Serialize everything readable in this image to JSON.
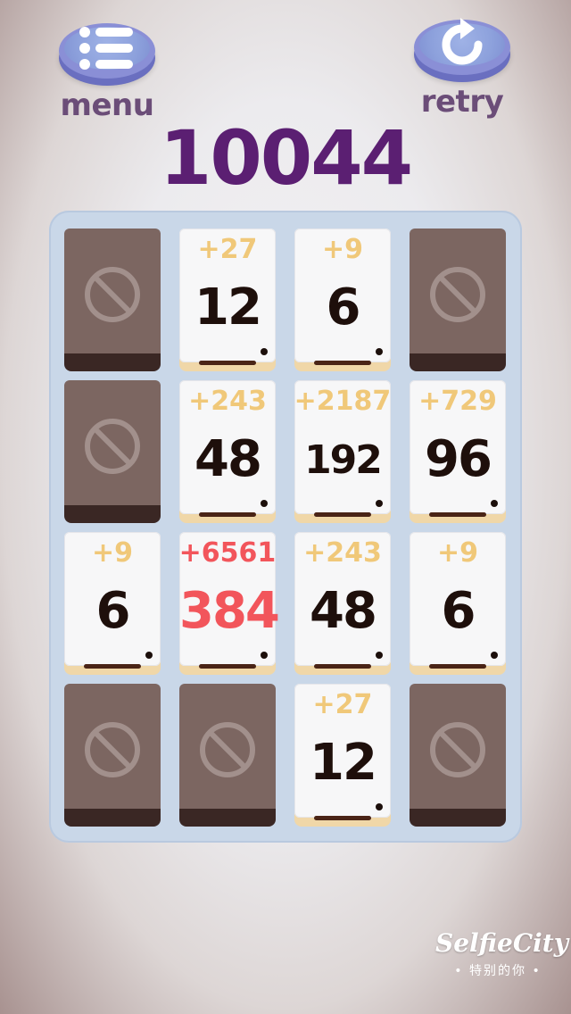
{
  "header": {
    "menu_label": "menu",
    "retry_label": "retry",
    "score": "10044"
  },
  "tiles": [
    {
      "row": 0,
      "col": 0,
      "type": "blocked",
      "value": "",
      "bonus": "",
      "highlight": false
    },
    {
      "row": 0,
      "col": 1,
      "type": "card",
      "value": "12",
      "bonus": "+27",
      "highlight": false
    },
    {
      "row": 0,
      "col": 2,
      "type": "card",
      "value": "6",
      "bonus": "+9",
      "highlight": false
    },
    {
      "row": 0,
      "col": 3,
      "type": "blocked",
      "value": "",
      "bonus": "",
      "highlight": false
    },
    {
      "row": 1,
      "col": 0,
      "type": "blocked",
      "value": "",
      "bonus": "",
      "highlight": false
    },
    {
      "row": 1,
      "col": 1,
      "type": "card",
      "value": "48",
      "bonus": "+243",
      "highlight": false
    },
    {
      "row": 1,
      "col": 2,
      "type": "card",
      "value": "192",
      "bonus": "+2187",
      "highlight": false
    },
    {
      "row": 1,
      "col": 3,
      "type": "card",
      "value": "96",
      "bonus": "+729",
      "highlight": false
    },
    {
      "row": 2,
      "col": 0,
      "type": "card",
      "value": "6",
      "bonus": "+9",
      "highlight": false
    },
    {
      "row": 2,
      "col": 1,
      "type": "card",
      "value": "384",
      "bonus": "+6561",
      "highlight": true
    },
    {
      "row": 2,
      "col": 2,
      "type": "card",
      "value": "48",
      "bonus": "+243",
      "highlight": false
    },
    {
      "row": 2,
      "col": 3,
      "type": "card",
      "value": "6",
      "bonus": "+9",
      "highlight": false
    },
    {
      "row": 3,
      "col": 0,
      "type": "blocked",
      "value": "",
      "bonus": "",
      "highlight": false
    },
    {
      "row": 3,
      "col": 1,
      "type": "blocked",
      "value": "",
      "bonus": "",
      "highlight": false
    },
    {
      "row": 3,
      "col": 2,
      "type": "card",
      "value": "12",
      "bonus": "+27",
      "highlight": false
    },
    {
      "row": 3,
      "col": 3,
      "type": "blocked",
      "value": "",
      "bonus": "",
      "highlight": false
    }
  ],
  "watermark": {
    "brand": "SelfieCity",
    "sub": "• 特别的你 •"
  },
  "colors": {
    "score": "#5b1f72",
    "bonus": "#f0c879",
    "highlight": "#f2555b",
    "blocked_tile": "#7c6661",
    "button": "#8da1dc"
  },
  "icons": {
    "menu": "list-icon",
    "retry": "retry-arrow-icon",
    "blocked": "no-entry-icon"
  }
}
